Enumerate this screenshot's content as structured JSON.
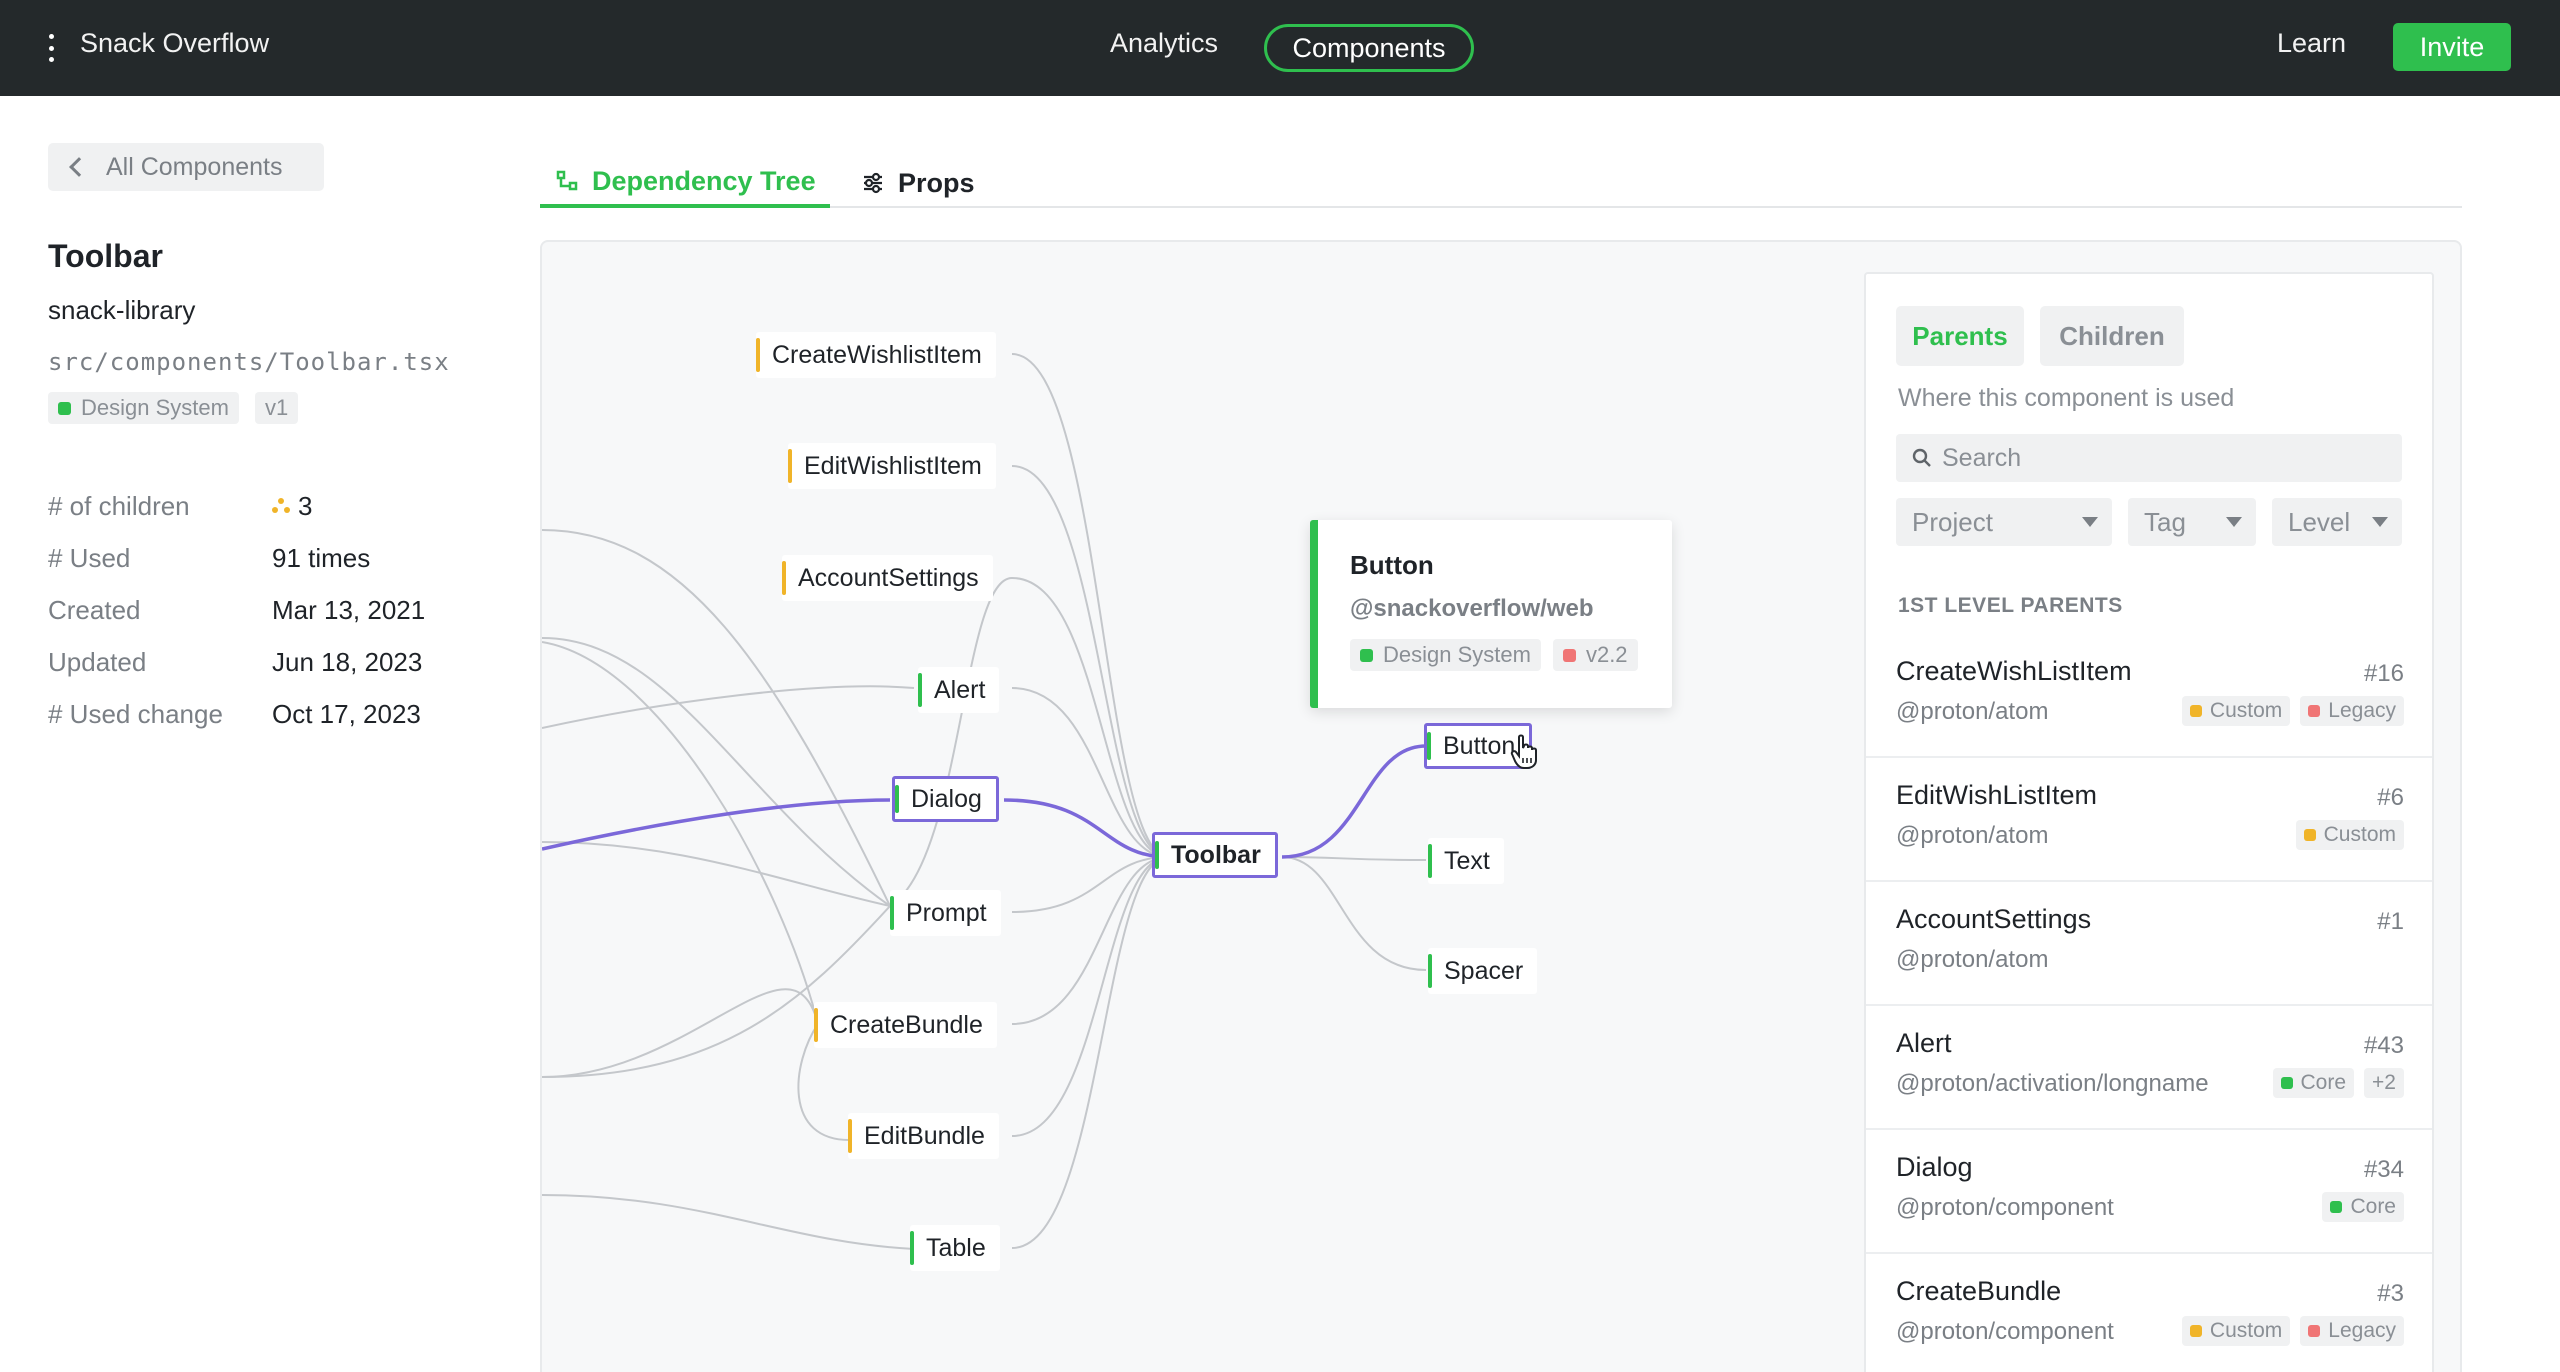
{
  "topbar": {
    "app_title": "Snack Overflow",
    "nav": {
      "analytics": "Analytics",
      "components": "Components"
    },
    "learn": "Learn",
    "invite": "Invite"
  },
  "sidebar": {
    "back_label": "All Components",
    "component_title": "Toolbar",
    "library": "snack-library",
    "path": "src/components/Toolbar.tsx",
    "tags": [
      {
        "label": "Design System",
        "color": "#2fbf4e"
      },
      {
        "label": "v1"
      }
    ],
    "meta": [
      {
        "label": "# of children",
        "value": "3"
      },
      {
        "label": "# Used",
        "value": "91 times"
      },
      {
        "label": "Created",
        "value": "Mar 13, 2021"
      },
      {
        "label": "Updated",
        "value": "Jun 18, 2023"
      },
      {
        "label": "# Used change",
        "value": "Oct 17, 2023"
      }
    ]
  },
  "tabs": {
    "dependency_tree": "Dependency Tree",
    "props": "Props",
    "active": "dependency_tree"
  },
  "tree": {
    "root": "Toolbar",
    "parents": [
      {
        "label": "CreateWishlistItem",
        "bar": "#f0b429"
      },
      {
        "label": "EditWishlistItem",
        "bar": "#f0b429"
      },
      {
        "label": "AccountSettings",
        "bar": "#f0b429"
      },
      {
        "label": "Alert",
        "bar": "#2fbf4e"
      },
      {
        "label": "Dialog",
        "bar": "#2fbf4e",
        "selected": true
      },
      {
        "label": "Prompt",
        "bar": "#2fbf4e"
      },
      {
        "label": "CreateBundle",
        "bar": "#f0b429"
      },
      {
        "label": "EditBundle",
        "bar": "#f0b429"
      },
      {
        "label": "Table",
        "bar": "#2fbf4e"
      }
    ],
    "children": [
      {
        "label": "Button",
        "bar": "#2fbf4e",
        "selected": true
      },
      {
        "label": "Text",
        "bar": "#2fbf4e"
      },
      {
        "label": "Spacer",
        "bar": "#2fbf4e"
      }
    ],
    "highlight_color": "#7b68d9",
    "popup": {
      "title": "Button",
      "package": "@snackoverflow/web",
      "tags": [
        {
          "label": "Design System",
          "color": "#2fbf4e"
        },
        {
          "label": "v2.2",
          "color": "#f07575"
        }
      ]
    }
  },
  "panel": {
    "toggle": {
      "parents": "Parents",
      "children": "Children",
      "active": "parents"
    },
    "hint": "Where this component is used",
    "search_placeholder": "Search",
    "filters": {
      "project": "Project",
      "tag": "Tag",
      "level": "Level"
    },
    "section_title": "1ST LEVEL PARENTS",
    "items": [
      {
        "name": "CreateWishListItem",
        "count": "#16",
        "package": "@proton/atom",
        "tags": [
          {
            "label": "Custom",
            "color": "#f0b429"
          },
          {
            "label": "Legacy",
            "color": "#f07575"
          }
        ]
      },
      {
        "name": "EditWishListItem",
        "count": "#6",
        "package": "@proton/atom",
        "tags": [
          {
            "label": "Custom",
            "color": "#f0b429"
          }
        ]
      },
      {
        "name": "AccountSettings",
        "count": "#1",
        "package": "@proton/atom",
        "tags": []
      },
      {
        "name": "Alert",
        "count": "#43",
        "package": "@proton/activation/longname",
        "tags": [
          {
            "label": "Core",
            "color": "#2fbf4e"
          },
          {
            "label": "+2"
          }
        ]
      },
      {
        "name": "Dialog",
        "count": "#34",
        "package": "@proton/component",
        "tags": [
          {
            "label": "Core",
            "color": "#2fbf4e"
          }
        ]
      },
      {
        "name": "CreateBundle",
        "count": "#3",
        "package": "@proton/component",
        "tags": [
          {
            "label": "Custom",
            "color": "#f0b429"
          },
          {
            "label": "Legacy",
            "color": "#f07575"
          }
        ]
      }
    ]
  },
  "colors": {
    "accent": "#2fbf4e",
    "topbar": "#24292b",
    "selection": "#7b68d9"
  }
}
